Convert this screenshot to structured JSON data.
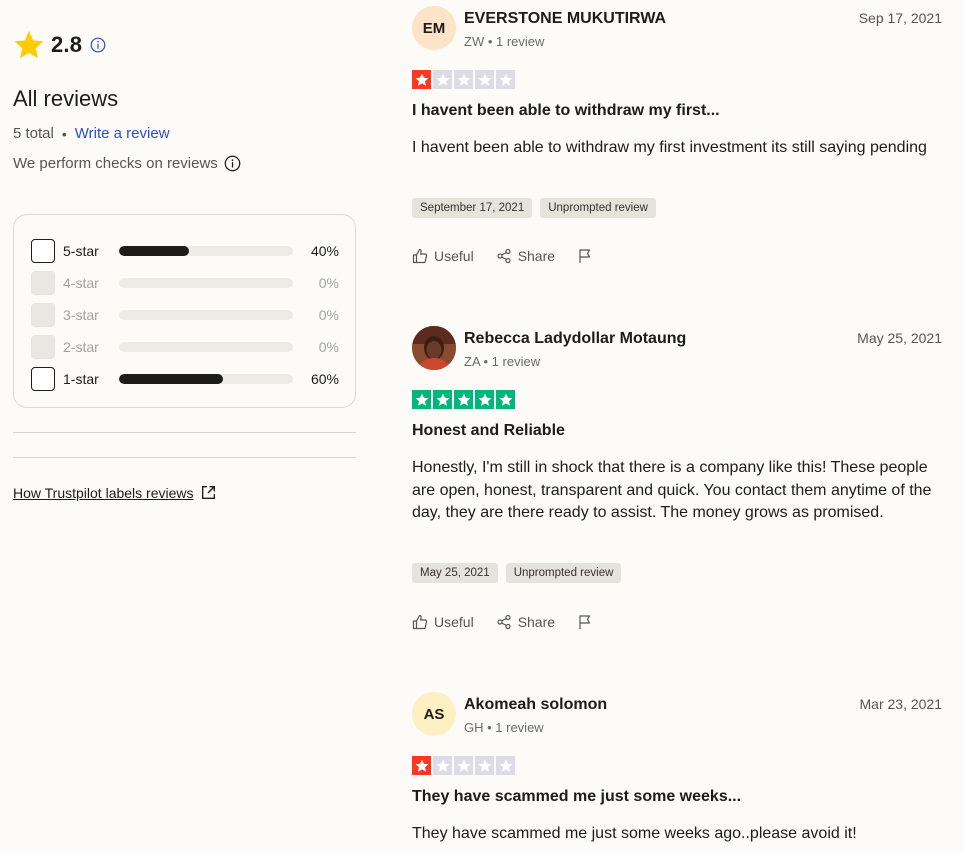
{
  "summary": {
    "rating": "2.8",
    "heading": "All reviews",
    "total": "5 total",
    "write_review": "Write a review",
    "checks_text": "We perform checks on reviews",
    "how_link": "How Trustpilot labels reviews",
    "star_color": "#ffcc00"
  },
  "filters": [
    {
      "label": "5-star",
      "percent": "40%",
      "fill": 0.4,
      "disabled": false
    },
    {
      "label": "4-star",
      "percent": "0%",
      "fill": 0.0,
      "disabled": true
    },
    {
      "label": "3-star",
      "percent": "0%",
      "fill": 0.0,
      "disabled": true
    },
    {
      "label": "2-star",
      "percent": "0%",
      "fill": 0.0,
      "disabled": true
    },
    {
      "label": "1-star",
      "percent": "60%",
      "fill": 0.6,
      "disabled": false
    }
  ],
  "reviews": [
    {
      "initials": "EM",
      "avatar_color": "#fde3c7",
      "name": "EVERSTONE MUKUTIRWA",
      "meta": "ZW • 1 review",
      "date": "Sep 17, 2021",
      "stars": 1,
      "title": "I havent been able to withdraw my first...",
      "body": "I havent been able to withdraw my first investment its still saying pending",
      "tags": [
        "September 17, 2021",
        "Unprompted review"
      ],
      "useful": "Useful",
      "share": "Share"
    },
    {
      "initials": "",
      "avatar_type": "photo",
      "name": "Rebecca Ladydollar Motaung",
      "meta": "ZA • 1 review",
      "date": "May 25, 2021",
      "stars": 5,
      "title": "Honest and Reliable",
      "body": "Honestly, I'm still in shock that there is a company like this! These people are open, honest, transparent and quick. You contact them anytime of the day, they are there ready to assist. The money grows as promised.",
      "tags": [
        "May 25, 2021",
        "Unprompted review"
      ],
      "useful": "Useful",
      "share": "Share"
    },
    {
      "initials": "AS",
      "avatar_color": "#fdf0c2",
      "name": "Akomeah solomon",
      "meta": "GH • 1 review",
      "date": "Mar 23, 2021",
      "stars": 1,
      "title": "They have scammed me just some weeks...",
      "body": "They have scammed me just some weeks ago..please avoid it!",
      "tags": [],
      "useful": "Useful",
      "share": "Share"
    }
  ],
  "colors": {
    "star_one": "#ff3722",
    "star_five": "#00b67a",
    "star_empty": "#dcdce6",
    "link": "#2d4fd1"
  }
}
